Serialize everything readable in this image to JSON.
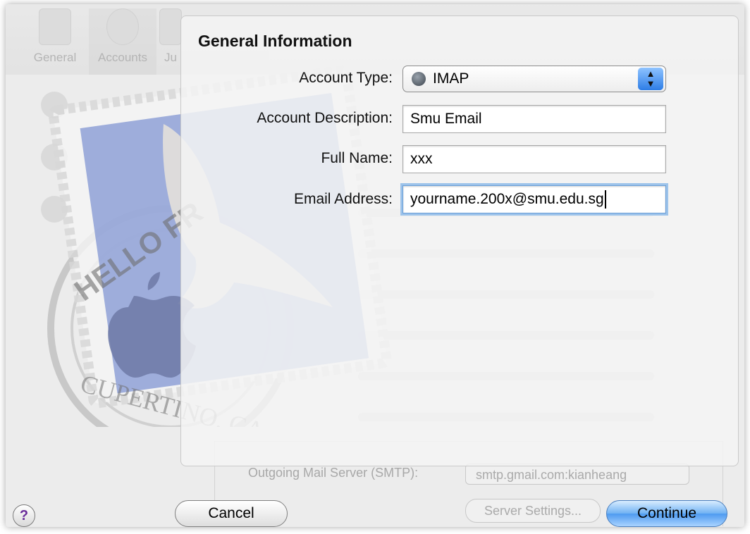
{
  "background": {
    "toolbar": [
      {
        "label": "General",
        "icon": "switch-icon"
      },
      {
        "label": "Accounts",
        "icon": "at-sign-icon"
      },
      {
        "label": "Ju",
        "icon": "junk-icon"
      }
    ],
    "accounts": [
      "",
      "",
      ""
    ],
    "smtp_label": "Outgoing Mail Server (SMTP):",
    "smtp_value": "smtp.gmail.com:kianheang",
    "server_settings_label": "Server Settings..."
  },
  "stamp": {
    "text_top": "HELLO FR",
    "text_bottom": "CUPERTINO, CA"
  },
  "sheet": {
    "title": "General Information",
    "fields": {
      "account_type": {
        "label": "Account Type:",
        "value": "IMAP",
        "icon": "globe-icon"
      },
      "account_description": {
        "label": "Account Description:",
        "value": "Smu Email"
      },
      "full_name": {
        "label": "Full Name:",
        "value": "xxx"
      },
      "email_address": {
        "label": "Email Address:",
        "value": "yourname.200x@smu.edu.sg"
      }
    }
  },
  "footer": {
    "help_label": "?",
    "cancel_label": "Cancel",
    "continue_label": "Continue"
  },
  "colors": {
    "focus_ring": "#9dc3ea",
    "primary_button": "#4d9af0",
    "help_glyph": "#6a2c9a"
  }
}
